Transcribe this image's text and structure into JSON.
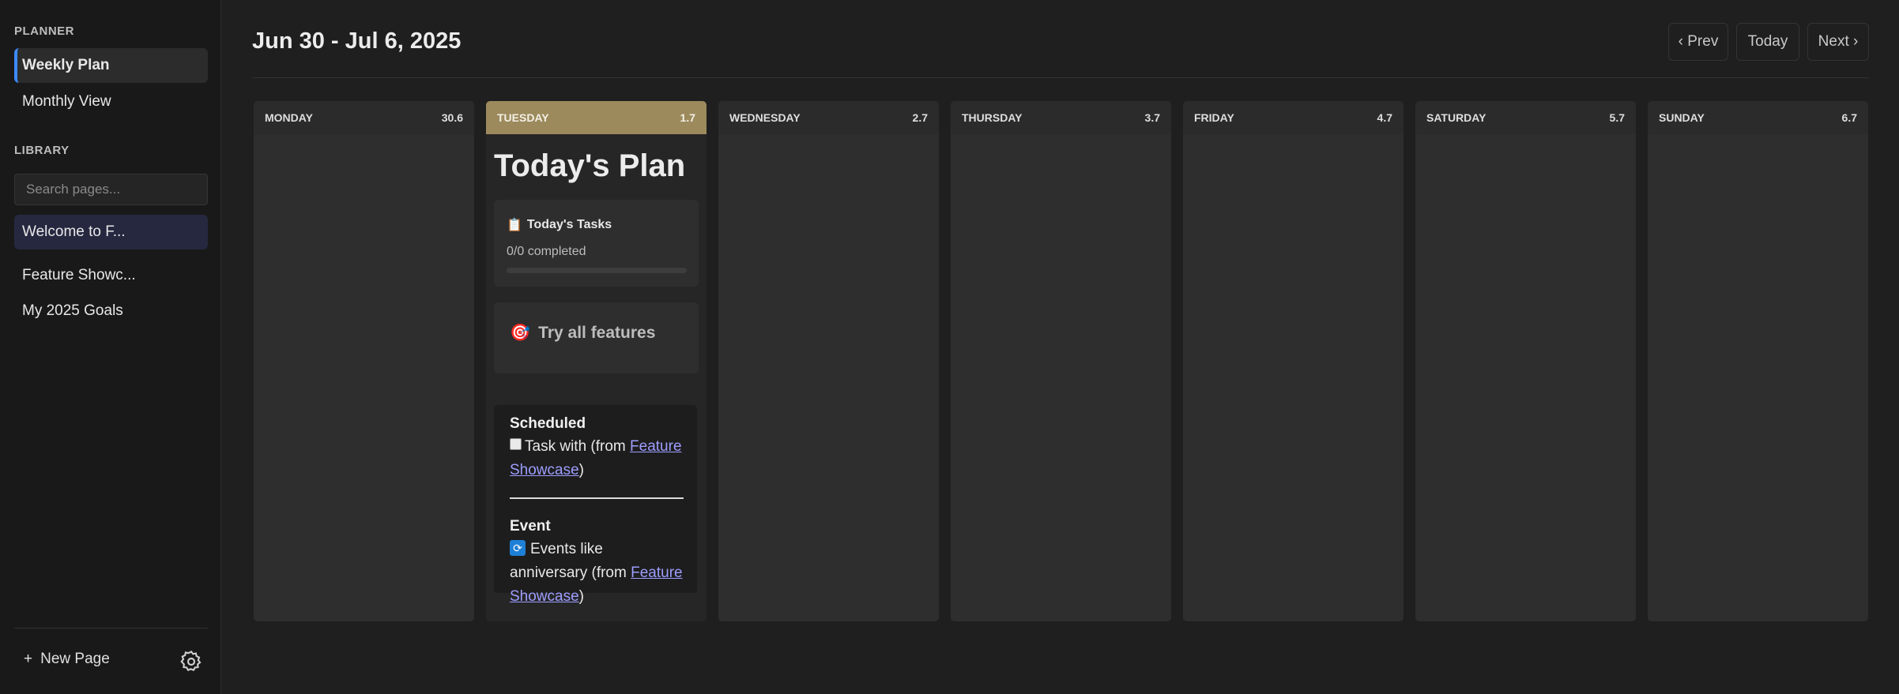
{
  "sidebar": {
    "planner_title": "PLANNER",
    "planner_items": [
      {
        "label": "Weekly Plan",
        "active": true
      },
      {
        "label": "Monthly View",
        "active": false
      }
    ],
    "library_title": "LIBRARY",
    "search_placeholder": "Search pages...",
    "pages": [
      {
        "label": "Welcome to F..."
      },
      {
        "label": "Feature Showc..."
      },
      {
        "label": "My 2025 Goals"
      }
    ],
    "new_page_label": "New Page",
    "new_page_icon": "+",
    "settings_icon": "gear-icon"
  },
  "header": {
    "title": "Jun 30 - Jul 6, 2025",
    "prev_label": "‹ Prev",
    "today_label": "Today",
    "next_label": "Next ›"
  },
  "week": {
    "days": [
      {
        "name": "MONDAY",
        "date": "30.6"
      },
      {
        "name": "TUESDAY",
        "date": "1.7",
        "today": true
      },
      {
        "name": "WEDNESDAY",
        "date": "2.7"
      },
      {
        "name": "THURSDAY",
        "date": "3.7"
      },
      {
        "name": "FRIDAY",
        "date": "4.7"
      },
      {
        "name": "SATURDAY",
        "date": "5.7"
      },
      {
        "name": "SUNDAY",
        "date": "6.7"
      }
    ]
  },
  "today_plan": {
    "title": "Today's Plan",
    "tasks_card": {
      "icon": "📋",
      "title": "Today's Tasks",
      "status": "0/0 completed",
      "progress": 0
    },
    "features_card": {
      "icon": "🎯",
      "label": "Try all features"
    },
    "scheduled": {
      "heading": "Scheduled",
      "task_text": "Task with (from ",
      "task_link": "Feature Showcase",
      "task_close": ")",
      "event_heading": "Event",
      "event_icon": "🔁",
      "event_text": "Events like anniversary (from ",
      "event_link": "Feature Showcase",
      "event_close": ")"
    }
  },
  "colors": {
    "accent": "#3d8bfd",
    "today_header": "#9c8a5d",
    "link": "#9d9dff"
  }
}
